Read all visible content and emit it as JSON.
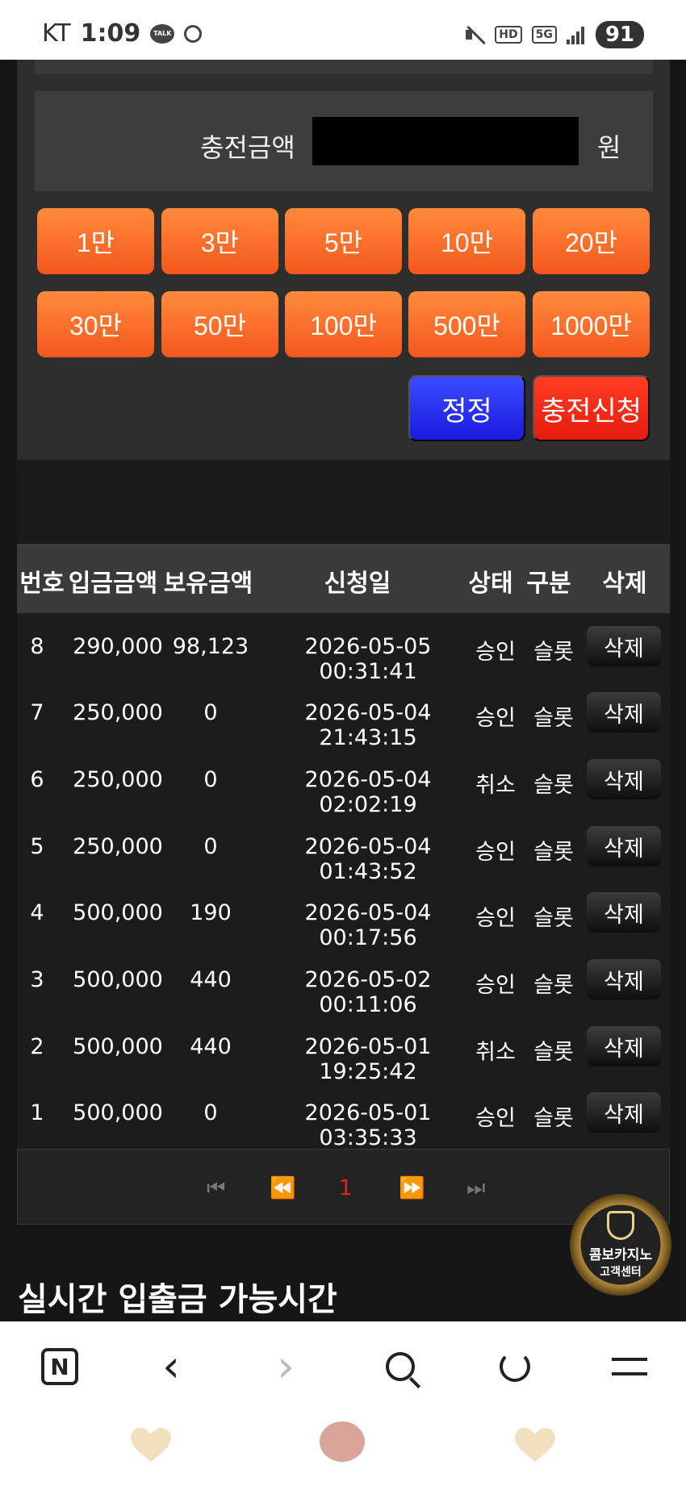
{
  "status_bar": {
    "carrier": "KT",
    "time": "1:09",
    "talk_badge": "TALK",
    "hd": "HD",
    "network": "5G",
    "battery": "91"
  },
  "charge_form": {
    "amount_label": "충전금액",
    "amount_value": "",
    "unit": "원",
    "amount_buttons": [
      "1만",
      "3만",
      "5만",
      "10만",
      "20만",
      "30만",
      "50만",
      "100만",
      "500만",
      "1000만"
    ],
    "fix_button": "정정",
    "request_button": "충전신청"
  },
  "history_table": {
    "headers": [
      "번호",
      "입금금액",
      "보유금액",
      "신청일",
      "상태",
      "구분",
      "삭제"
    ],
    "rows": [
      {
        "no": "8",
        "deposit": "290,000",
        "balance": "98,123",
        "date": "2026-05-05 00:31:41",
        "status": "승인",
        "type": "슬롯",
        "action": "삭제"
      },
      {
        "no": "7",
        "deposit": "250,000",
        "balance": "0",
        "date": "2026-05-04 21:43:15",
        "status": "승인",
        "type": "슬롯",
        "action": "삭제"
      },
      {
        "no": "6",
        "deposit": "250,000",
        "balance": "0",
        "date": "2026-05-04 02:02:19",
        "status": "취소",
        "type": "슬롯",
        "action": "삭제"
      },
      {
        "no": "5",
        "deposit": "250,000",
        "balance": "0",
        "date": "2026-05-04 01:43:52",
        "status": "승인",
        "type": "슬롯",
        "action": "삭제"
      },
      {
        "no": "4",
        "deposit": "500,000",
        "balance": "190",
        "date": "2026-05-04 00:17:56",
        "status": "승인",
        "type": "슬롯",
        "action": "삭제"
      },
      {
        "no": "3",
        "deposit": "500,000",
        "balance": "440",
        "date": "2026-05-02 00:11:06",
        "status": "승인",
        "type": "슬롯",
        "action": "삭제"
      },
      {
        "no": "2",
        "deposit": "500,000",
        "balance": "440",
        "date": "2026-05-01 19:25:42",
        "status": "취소",
        "type": "슬롯",
        "action": "삭제"
      },
      {
        "no": "1",
        "deposit": "500,000",
        "balance": "0",
        "date": "2026-05-01 03:35:33",
        "status": "승인",
        "type": "슬롯",
        "action": "삭제"
      }
    ]
  },
  "pagination": {
    "first": "⏮",
    "prev": "⏪",
    "current": "1",
    "next": "⏩",
    "last": "⏭"
  },
  "section_title": "실시간 입출금 가능시간",
  "support_badge": {
    "line1": "콤보카지노",
    "line2": "고객센터"
  },
  "browser_nav": {
    "logo": "N",
    "back": "‹",
    "forward": "›"
  },
  "colors": {
    "orange_button": "#f5571c",
    "blue_button": "#1a1ae0",
    "red_button": "#e51b10",
    "current_page": "#e02626"
  }
}
